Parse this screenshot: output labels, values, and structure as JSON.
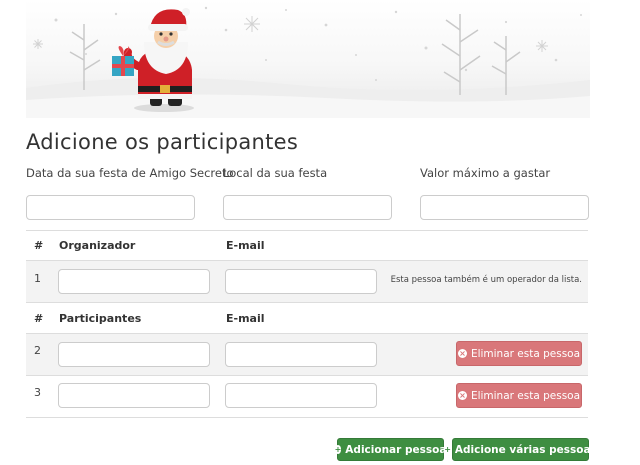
{
  "page": {
    "title": "Adicione os participantes"
  },
  "party": {
    "date_label": "Data da sua festa de Amigo Secreto",
    "location_label": "Local da sua festa",
    "max_value_label": "Valor máximo a gastar",
    "date_value": "",
    "location_value": "",
    "max_value_value": ""
  },
  "organizer_table": {
    "col_number": "#",
    "col_name": "Organizador",
    "col_email": "E-mail",
    "rows": [
      {
        "number": "1",
        "name": "",
        "email": "",
        "note": "Esta pessoa também é um operador da lista."
      }
    ]
  },
  "participants_table": {
    "col_number": "#",
    "col_name": "Participantes",
    "col_email": "E-mail",
    "rows": [
      {
        "number": "2",
        "name": "",
        "email": "",
        "remove_label": "Eliminar esta pessoa"
      },
      {
        "number": "3",
        "name": "",
        "email": "",
        "remove_label": "Eliminar esta pessoa"
      }
    ]
  },
  "actions": {
    "add_person_label": "Adicionar pessoa",
    "add_many_label": "Adicione várias pessoas"
  },
  "icons": {
    "remove": "times-circle-icon",
    "add": "plus-circle-icon",
    "banner": "santa-claus-illustration"
  },
  "colors": {
    "danger": "#d9777a",
    "success": "#3e8e41"
  }
}
